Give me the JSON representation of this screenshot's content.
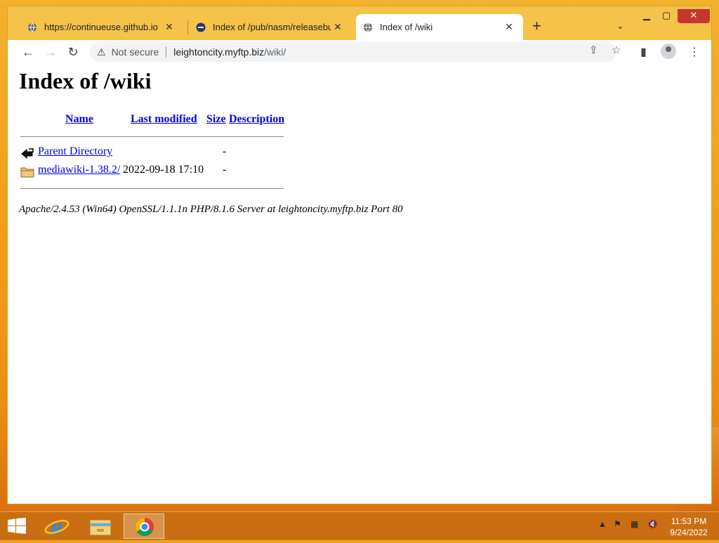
{
  "browser": {
    "tabs": [
      {
        "title": "https://continueuse.github.io",
        "favicon": "globe-icon",
        "active": false
      },
      {
        "title": "Index of /pub/nasm/releasebuilds",
        "favicon": "nasm-icon",
        "active": false
      },
      {
        "title": "Index of /wiki",
        "favicon": "globe-icon",
        "active": true
      }
    ],
    "new_tab_label": "+",
    "security_label": "Not secure",
    "url_host": "leightoncity.myftp.biz",
    "url_path": "/wiki/"
  },
  "page": {
    "heading": "Index of /wiki",
    "columns": {
      "name": "Name",
      "last_modified": "Last modified",
      "size": "Size",
      "description": "Description"
    },
    "rows": [
      {
        "icon": "back-arrow-icon",
        "name": "Parent Directory",
        "modified": "",
        "size": "-"
      },
      {
        "icon": "folder-icon",
        "name": "mediawiki-1.38.2/",
        "modified": "2022-09-18 17:10",
        "size": "-"
      }
    ],
    "footer": "Apache/2.4.53 (Win64) OpenSSL/1.1.1n PHP/8.1.6 Server at leightoncity.myftp.biz Port 80"
  },
  "taskbar": {
    "apps": [
      "internet-explorer-icon",
      "file-explorer-icon",
      "chrome-icon"
    ],
    "active_app": "chrome-icon",
    "time": "11:53 PM",
    "date": "9/24/2022"
  },
  "colors": {
    "link": "#0000ee",
    "titlebar": "#f5c24a",
    "close_button": "#c7352b"
  }
}
